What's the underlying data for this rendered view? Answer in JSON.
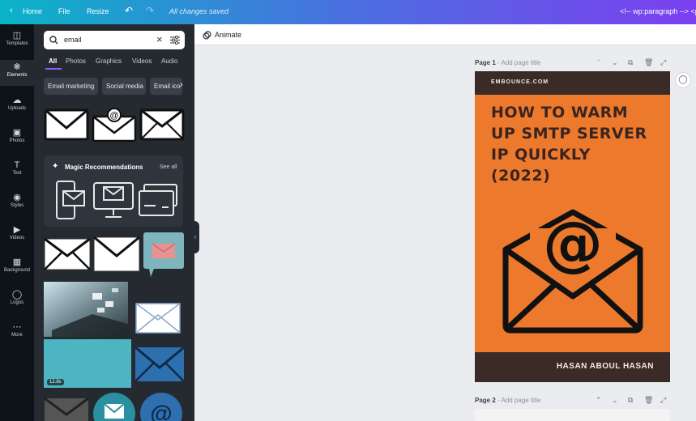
{
  "topbar": {
    "home": "Home",
    "file": "File",
    "resize": "Resize",
    "status": "All changes saved",
    "code_text": "<!-- wp:paragraph --> <p>"
  },
  "rail": [
    {
      "label": "Templates",
      "icon": "templates-icon"
    },
    {
      "label": "Elements",
      "icon": "elements-icon"
    },
    {
      "label": "Uploads",
      "icon": "uploads-icon"
    },
    {
      "label": "Photos",
      "icon": "photos-icon"
    },
    {
      "label": "Text",
      "icon": "text-icon"
    },
    {
      "label": "Styles",
      "icon": "styles-icon"
    },
    {
      "label": "Videos",
      "icon": "videos-icon"
    },
    {
      "label": "Background",
      "icon": "background-icon"
    },
    {
      "label": "Logos",
      "icon": "logos-icon"
    },
    {
      "label": "More",
      "icon": "more-icon"
    }
  ],
  "panel": {
    "search_value": "email",
    "tabs": [
      "All",
      "Photos",
      "Graphics",
      "Videos",
      "Audio"
    ],
    "chips": [
      "Email marketing",
      "Social media",
      "Email ico"
    ],
    "magic_title": "Magic Recommendations",
    "see_all": "See all",
    "video_duration": "12.8s"
  },
  "toolbar": {
    "animate": "Animate"
  },
  "pages": [
    {
      "label": "Page 1",
      "placeholder": "- Add page title"
    },
    {
      "label": "Page 2",
      "placeholder": "- Add page title"
    }
  ],
  "design": {
    "brand": "EMBOUNCE.COM",
    "title_lines": [
      "HOW TO WARM",
      "UP SMTP SERVER",
      "IP QUICKLY",
      "(2022)"
    ],
    "author": "HASAN ABOUL HASAN"
  },
  "colors": {
    "design_orange": "#ed7a2c",
    "design_dark": "#3a2a28",
    "accent_teal": "#4db5c2",
    "accent_blue": "#2e6fb0"
  }
}
